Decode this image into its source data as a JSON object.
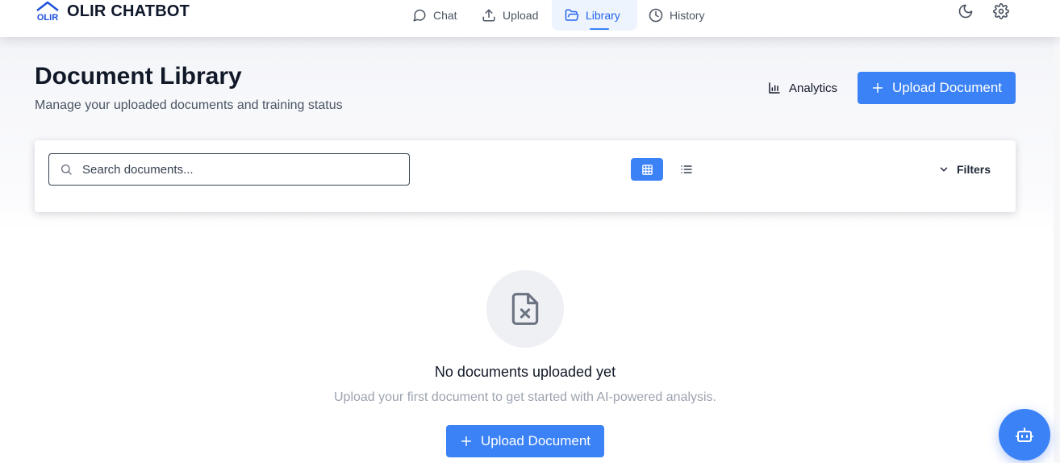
{
  "header": {
    "brand_name": "OLIR CHATBOT",
    "brand_logo_text": "OLIR",
    "nav": [
      {
        "label": "Chat",
        "icon": "chat-bubble-icon",
        "active": false
      },
      {
        "label": "Upload",
        "icon": "upload-icon",
        "active": false
      },
      {
        "label": "Library",
        "icon": "folder-open-icon",
        "active": true
      },
      {
        "label": "History",
        "icon": "clock-icon",
        "active": false
      }
    ],
    "theme_toggle_icon": "moon-icon",
    "settings_icon": "gear-icon"
  },
  "page": {
    "title": "Document Library",
    "subtitle": "Manage your uploaded documents and training status",
    "analytics_label": "Analytics",
    "upload_label": "Upload Document"
  },
  "toolbar": {
    "search_placeholder": "Search documents...",
    "search_value": "",
    "view_modes": [
      "grid",
      "list"
    ],
    "active_view": "grid",
    "filters_label": "Filters"
  },
  "empty_state": {
    "icon": "file-x-icon",
    "title": "No documents uploaded yet",
    "subtitle": "Upload your first document to get started with AI-powered analysis.",
    "button_label": "Upload Document"
  },
  "fab": {
    "icon": "bot-icon"
  },
  "colors": {
    "accent": "#3b82f6",
    "accent_text": "#2563eb",
    "active_nav_bg": "#eef4fe",
    "muted_text": "#9ca3af"
  }
}
